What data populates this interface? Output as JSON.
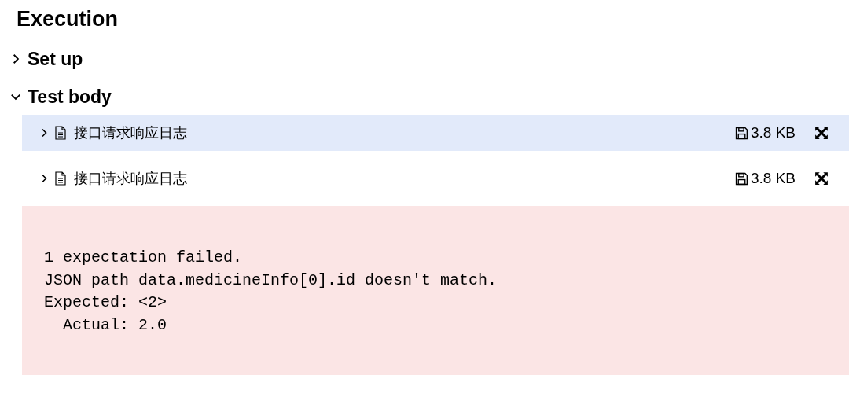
{
  "title": "Execution",
  "sections": [
    {
      "name": "Set up",
      "expanded": false
    },
    {
      "name": "Test body",
      "expanded": true,
      "attachments": [
        {
          "name": "接口请求响应日志",
          "size": "3.8 KB",
          "selected": true
        },
        {
          "name": "接口请求响应日志",
          "size": "3.8 KB",
          "selected": false
        }
      ],
      "error_message": [
        "1 expectation failed.",
        "JSON path data.medicineInfo[0].id doesn't match.",
        "Expected: <2>",
        "  Actual: 2.0"
      ]
    }
  ]
}
